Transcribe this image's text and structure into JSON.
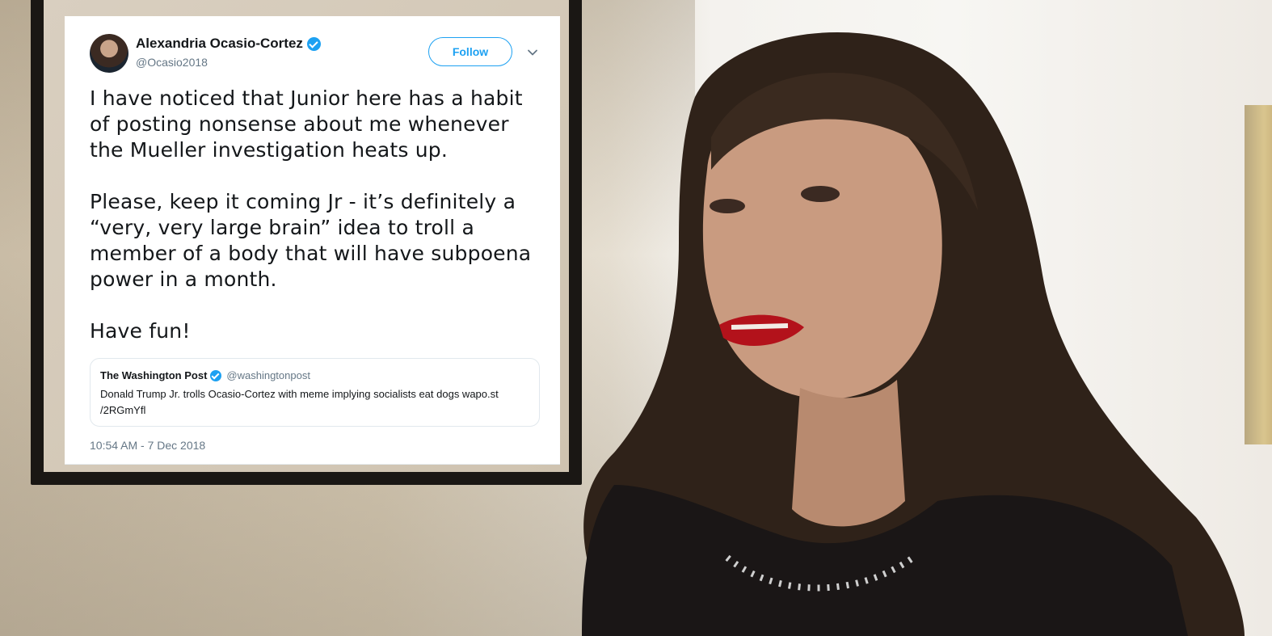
{
  "tweet": {
    "author": {
      "display_name": "Alexandria Ocasio-Cortez",
      "handle": "@Ocasio2018",
      "verified": true
    },
    "follow_label": "Follow",
    "body": [
      "I have noticed that Junior here has a habit of posting nonsense about me whenever the Mueller investigation heats up.",
      "Please, keep it coming Jr - it’s definitely a “very, very large brain” idea to troll a member of a body that will have subpoena power in a month.",
      "Have fun!"
    ],
    "quoted": {
      "display_name": "The Washington Post",
      "handle": "@washingtonpost",
      "verified": true,
      "text": "Donald Trump Jr. trolls Ocasio-Cortez with meme implying socialists eat dogs wapo.st /2RGmYfl"
    },
    "timestamp": "10:54 AM - 7 Dec 2018"
  },
  "colors": {
    "accent": "#1da1f2",
    "text_primary": "#14171a",
    "text_secondary": "#657786",
    "border": "#e1e8ed"
  },
  "icons": {
    "verified": "verified-badge-icon",
    "more": "chevron-down-icon"
  }
}
